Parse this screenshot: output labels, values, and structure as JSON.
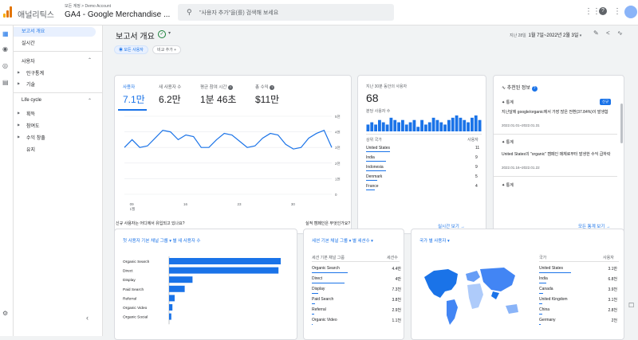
{
  "header": {
    "app_name": "애널리틱스",
    "breadcrumb": "모든 계정 > Demo Account",
    "property": "GA4 - Google Merchandise ...",
    "search_placeholder": "\"사용자 추가\"을(를) 검색해 보세요"
  },
  "nav": {
    "items": [
      "보고서 개요",
      "실시간"
    ],
    "section_users": "사용자",
    "users_items": [
      "인구통계",
      "기술"
    ],
    "section_lifecycle": "Life cycle",
    "lifecycle_items": [
      "획득",
      "참여도",
      "수익 창출",
      "유지"
    ]
  },
  "page": {
    "title": "보고서 개요",
    "date_label": "지난 28일",
    "date_range": "1월 7일~2022년 2월 3일",
    "compare_chip": "모든 사용자",
    "add_compare": "비교 추가 +"
  },
  "kpis": [
    {
      "label": "사용자",
      "value": "7.1만"
    },
    {
      "label": "새 사용자 수",
      "value": "6.2만"
    },
    {
      "label": "평균 참여 시간",
      "value": "1분 46초"
    },
    {
      "label": "총 수익",
      "value": "$11만"
    }
  ],
  "chart_data": {
    "type": "line",
    "series": [
      {
        "values": [
          3.0,
          3.5,
          3.0,
          3.1,
          3.6,
          4.1,
          4.0,
          3.5,
          3.8,
          3.7,
          3.0,
          3.0,
          3.5,
          3.9,
          3.8,
          3.4,
          3.0,
          3.1,
          3.6,
          3.9,
          3.8,
          3.2,
          2.9,
          3.0,
          3.6,
          3.9,
          4.1,
          3.0
        ]
      }
    ],
    "x_ticks": [
      "09\n1월",
      "16",
      "23",
      "30"
    ],
    "y_ticks": [
      "5천",
      "4천",
      "3천",
      "2천",
      "1천",
      "0"
    ],
    "ylim": [
      0,
      5
    ]
  },
  "chart_labels": {
    "x_ticks": [
      "09",
      "1월",
      "16",
      "23",
      "30"
    ],
    "y_ticks": [
      "5천",
      "4천",
      "3천",
      "2천",
      "1천",
      "0"
    ]
  },
  "realtime": {
    "title": "지난 30분 동안의 사용자",
    "value": "68",
    "sub": "분당 사용자 수",
    "bars": [
      3,
      4,
      3,
      5,
      4,
      3,
      6,
      5,
      4,
      5,
      3,
      4,
      5,
      2,
      5,
      3,
      4,
      6,
      5,
      4,
      3,
      5,
      6,
      7,
      6,
      5,
      4,
      6,
      7,
      5
    ],
    "col_left": "상위 국가",
    "col_right": "사용자",
    "rows": [
      {
        "country": "United States",
        "users": "11"
      },
      {
        "country": "India",
        "users": "9"
      },
      {
        "country": "Indonesia",
        "users": "9"
      },
      {
        "country": "Denmark",
        "users": "5"
      },
      {
        "country": "France",
        "users": "4"
      }
    ],
    "link": "실시간 보기 →"
  },
  "insights": {
    "title": "추천된 정보",
    "item1_label": "통계",
    "item1_badge": "신규",
    "item1_text": "지난달에 google/organic에서 가장 많은 전환(37.84%)이 발생함",
    "item1_date": "2022.01.01~2022.01.31",
    "item2_label": "통계",
    "item2_text": "United States의 \"organic\" 캠페인 매체로부터 발생한 수익 급하락",
    "item2_date": "2022.01.16~2022.01.22",
    "item3_label": "통계",
    "link": "모든 통계 보기 →"
  },
  "acquisition": {
    "question": "신규 사용자는 어디에서 유입되고 있나요?",
    "dropdown": "첫 사용자 기본 채널 그룹 ▾ 별 새 사용자 수",
    "chart_data": {
      "type": "bar",
      "categories": [
        "Organic Search",
        "Direct",
        "Display",
        "Paid Search",
        "Referral",
        "Organic Video",
        "Organic Social"
      ],
      "values": [
        100,
        98,
        21,
        14,
        5,
        3,
        2
      ]
    }
  },
  "performance": {
    "question": "실적 캠페인은 무엇인가요?",
    "dropdown": "세션 기본 채널 그룹 ▾ 별 세션수 ▾",
    "col_left": "세션 기본 채널 그룹",
    "col_right": "세션수",
    "rows": [
      {
        "name": "Organic Search",
        "value": "4.4만",
        "share": 100
      },
      {
        "name": "Direct",
        "value": "4만",
        "share": 91
      },
      {
        "name": "Display",
        "value": "7.3천",
        "share": 17
      },
      {
        "name": "Paid Search",
        "value": "3.8천",
        "share": 9
      },
      {
        "name": "Referral",
        "value": "2.9천",
        "share": 7
      },
      {
        "name": "Organic Video",
        "value": "1.1천",
        "share": 3
      }
    ]
  },
  "geo": {
    "dropdown": "국가 별 사용자 ▾",
    "col_left": "국가",
    "col_right": "사용자",
    "rows": [
      {
        "country": "United States",
        "users": "3.1만"
      },
      {
        "country": "India",
        "users": "6.8천"
      },
      {
        "country": "Canada",
        "users": "3.9천"
      },
      {
        "country": "United Kingdom",
        "users": "3.1천"
      },
      {
        "country": "China",
        "users": "2.8천"
      },
      {
        "country": "Germany",
        "users": "2천"
      }
    ]
  },
  "colors": {
    "accent": "#1a73e8",
    "green": "#188038"
  }
}
